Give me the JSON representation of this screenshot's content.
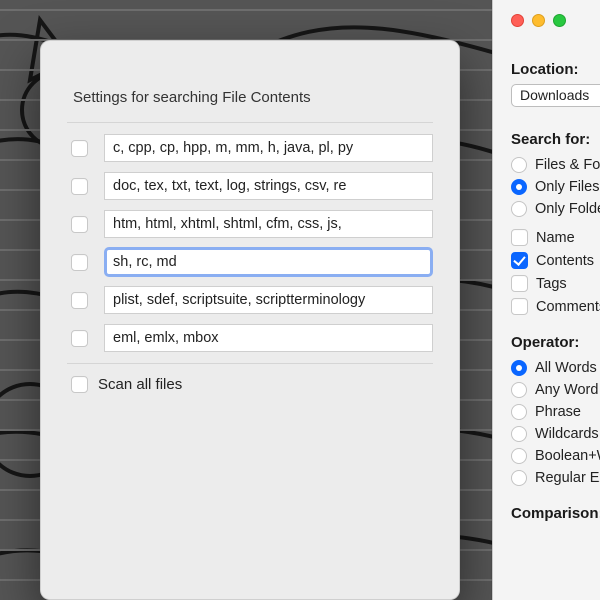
{
  "settings": {
    "title": "Settings for searching File Contents",
    "rows": [
      {
        "checked": false,
        "value": "c, cpp, cp, hpp, m, mm, h, java, pl, py"
      },
      {
        "checked": false,
        "value": "doc, tex, txt, text, log, strings, csv, re"
      },
      {
        "checked": false,
        "value": "htm, html, xhtml, shtml, cfm, css, js,"
      },
      {
        "checked": false,
        "value": "sh, rc, md",
        "focused": true
      },
      {
        "checked": false,
        "value": "plist, sdef, scriptsuite, scriptterminology"
      },
      {
        "checked": false,
        "value": "eml, emlx, mbox"
      }
    ],
    "scan_all": {
      "checked": false,
      "label": "Scan all files"
    }
  },
  "panel": {
    "location": {
      "label": "Location:",
      "value": "Downloads"
    },
    "search_for": {
      "label": "Search for:",
      "type_options": [
        {
          "label": "Files & Folders",
          "selected": false
        },
        {
          "label": "Only Files",
          "selected": true
        },
        {
          "label": "Only Folders",
          "selected": false
        }
      ],
      "field_options": [
        {
          "label": "Name",
          "checked": false
        },
        {
          "label": "Contents",
          "checked": true
        },
        {
          "label": "Tags",
          "checked": false
        },
        {
          "label": "Comments",
          "checked": false
        }
      ]
    },
    "operator": {
      "label": "Operator:",
      "options": [
        {
          "label": "All Words",
          "selected": true
        },
        {
          "label": "Any Word",
          "selected": false
        },
        {
          "label": "Phrase",
          "selected": false
        },
        {
          "label": "Wildcards",
          "selected": false
        },
        {
          "label": "Boolean+Wildcards",
          "selected": false
        },
        {
          "label": "Regular Expression",
          "selected": false
        }
      ]
    },
    "comparison_label": "Comparison:"
  }
}
